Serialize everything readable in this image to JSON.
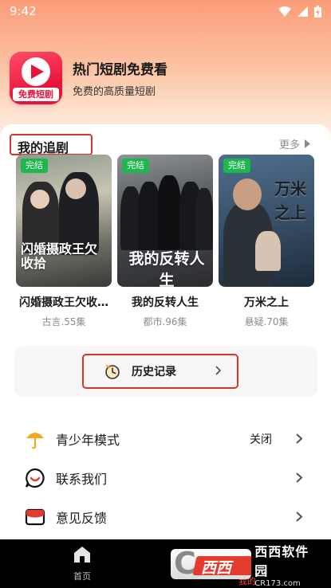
{
  "status_bar": {
    "time": "9:42"
  },
  "app": {
    "logo_text": "免费短剧",
    "title": "热门短剧免费看",
    "subtitle": "免费的高质量短剧"
  },
  "my_dramas": {
    "title": "我的追剧",
    "more_label": "更多",
    "items": [
      {
        "badge": "完结",
        "title": "闪婚摄政王欠收…",
        "meta": "古言.55集",
        "poster_text": "闪婚摄政王欠收拾"
      },
      {
        "badge": "完结",
        "title": "我的反转人生",
        "meta": "都市.96集",
        "poster_text": "我的反转人生"
      },
      {
        "badge": "完结",
        "title": "万米之上",
        "meta": "悬疑.70集",
        "poster_text": "万米之上"
      }
    ]
  },
  "history": {
    "label": "历史记录"
  },
  "settings": [
    {
      "label": "青少年模式",
      "value": "关闭",
      "icon": "umbrella-icon"
    },
    {
      "label": "联系我们",
      "value": "",
      "icon": "chat-icon"
    },
    {
      "label": "意见反馈",
      "value": "",
      "icon": "feedback-icon"
    }
  ],
  "bottom_nav": {
    "home_label": "首页",
    "mine_label": "我的"
  },
  "watermark": {
    "brand": "西西软件园",
    "url": "CR173.com"
  },
  "colors": {
    "accent_red": "#d9342b",
    "badge_green": "#1db84c",
    "logo_red": "#e8123c",
    "umbrella_orange": "#f5a623"
  }
}
